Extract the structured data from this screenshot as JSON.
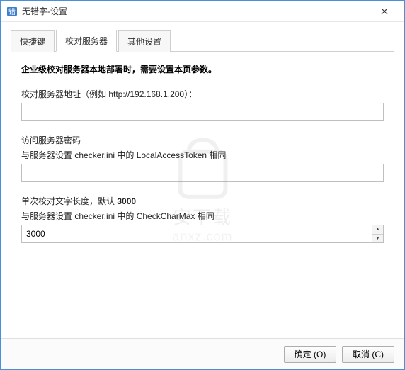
{
  "window": {
    "title": "无错字-设置"
  },
  "tabs": {
    "items": [
      {
        "label": "快捷键"
      },
      {
        "label": "校对服务器"
      },
      {
        "label": "其他设置"
      }
    ],
    "active_index": 1
  },
  "panel": {
    "heading": "企业级校对服务器本地部署时，需要设置本页参数。",
    "server_address": {
      "label": "校对服务器地址（例如 http://192.168.1.200）：",
      "value": ""
    },
    "password": {
      "label": "访问服务器密码",
      "sublabel": "与服务器设置 checker.ini 中的 LocalAccessToken 相同",
      "value": ""
    },
    "max_chars": {
      "label_prefix": "单次校对文字长度，默认 ",
      "label_default": "3000",
      "sublabel": "与服务器设置 checker.ini 中的 CheckCharMax 相同",
      "value": "3000"
    }
  },
  "footer": {
    "ok_label": "确定 (O)",
    "cancel_label": "取消 (C)"
  },
  "watermark": {
    "line1": "安下载",
    "line2": "anxz.com"
  }
}
